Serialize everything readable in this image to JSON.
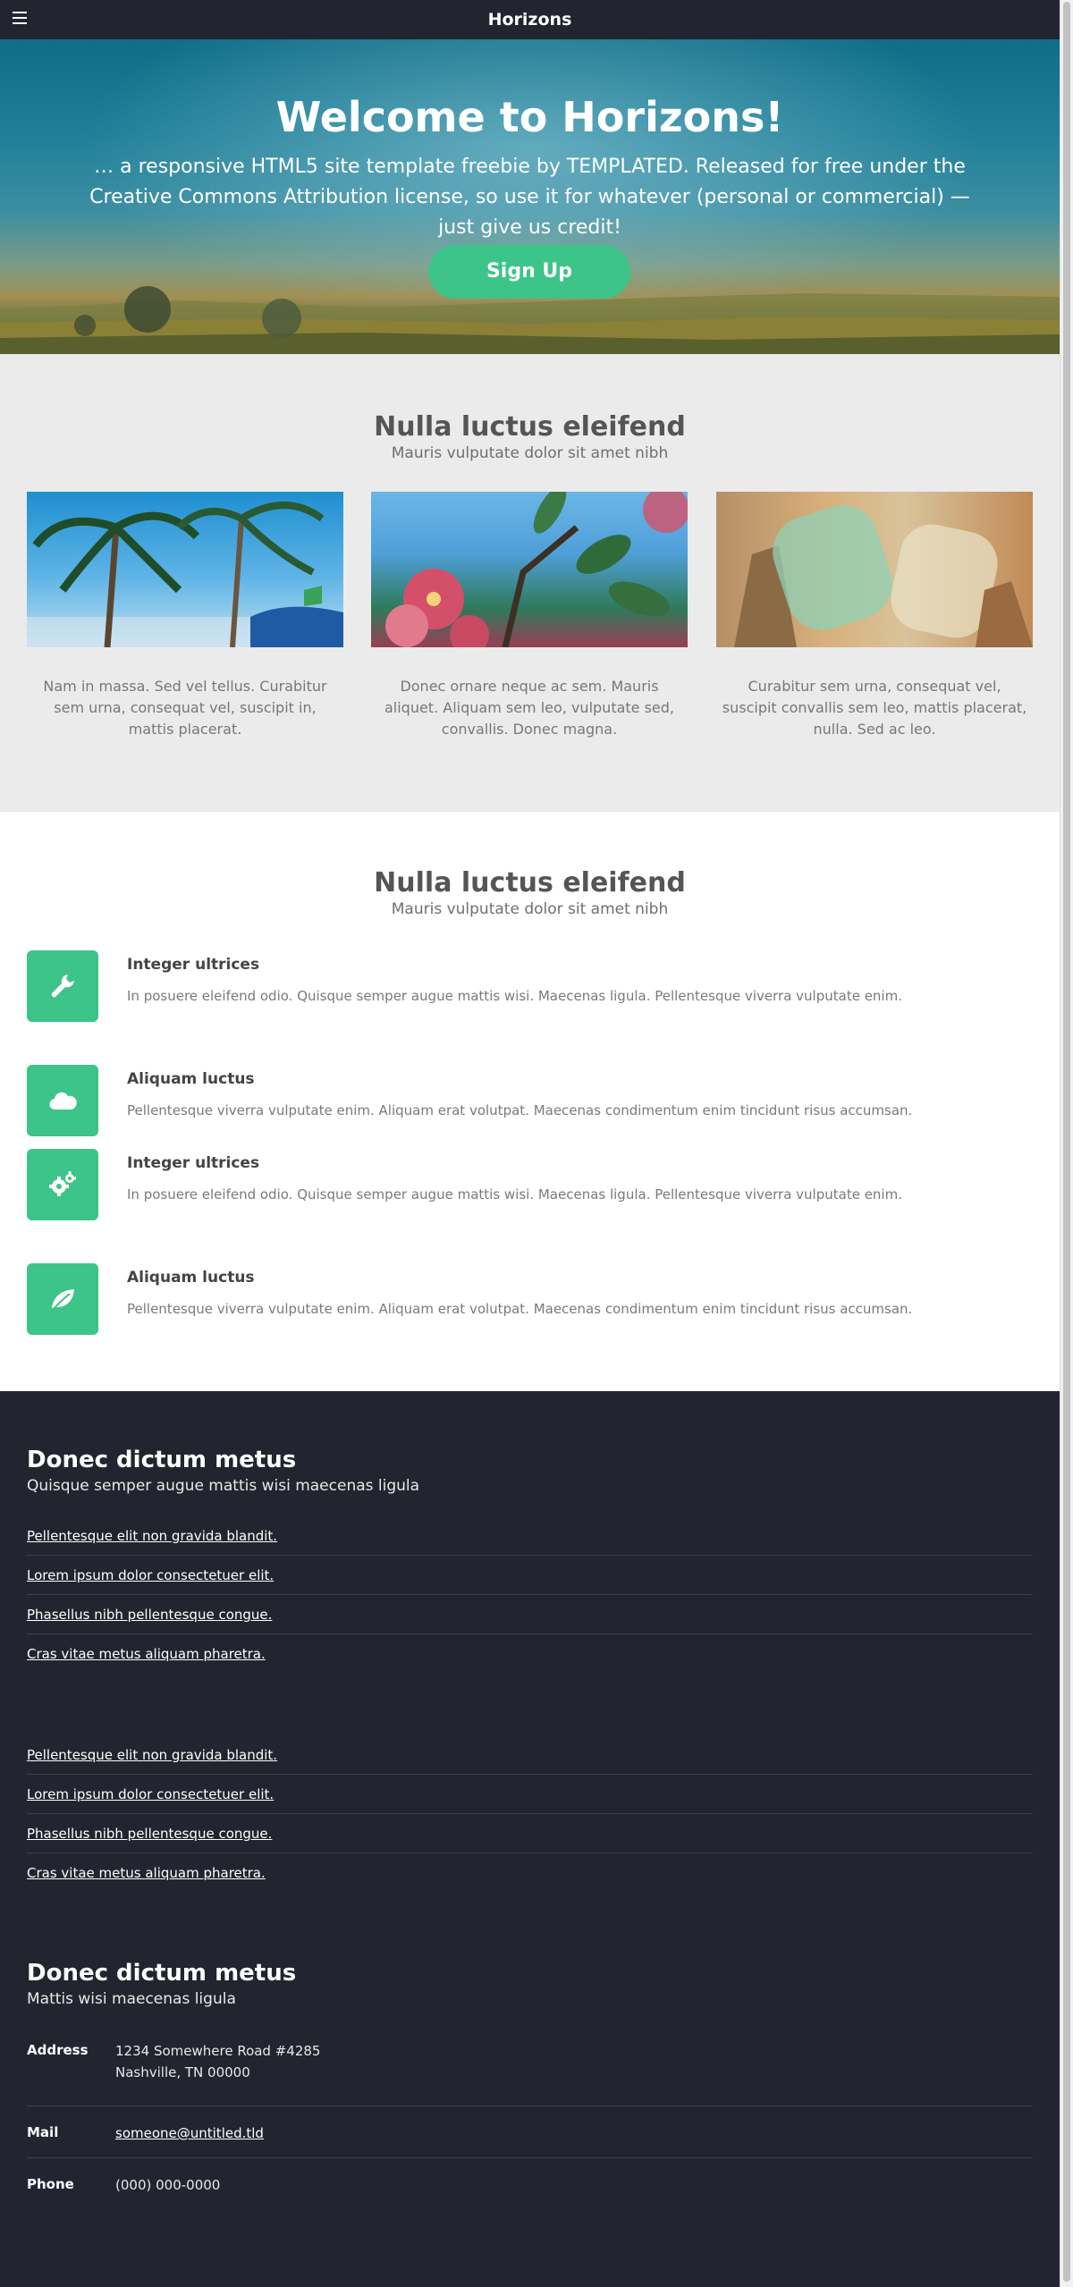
{
  "header": {
    "title": "Horizons",
    "menu_icon": "hamburger-menu-icon"
  },
  "banner": {
    "heading": "Welcome to Horizons!",
    "text": "… a responsive HTML5 site template freebie by TEMPLATED. Released for free under the Creative Commons Attribution license, so use it for whatever (personal or commercial) — just give us credit!",
    "cta_label": "Sign Up"
  },
  "section_one": {
    "title": "Nulla luctus eleifend",
    "subtitle": "Mauris vulputate dolor sit amet nibh",
    "cards": [
      {
        "text": "Nam in massa. Sed vel tellus. Curabitur sem urna, consequat vel, suscipit in, mattis placerat."
      },
      {
        "text": "Donec ornare neque ac sem. Mauris aliquet. Aliquam sem leo, vulputate sed, convallis. Donec magna."
      },
      {
        "text": "Curabitur sem urna, consequat vel, suscipit convallis sem leo, mattis placerat, nulla. Sed ac leo."
      }
    ]
  },
  "section_two": {
    "title": "Nulla luctus eleifend",
    "subtitle": "Mauris vulputate dolor sit amet nibh",
    "features": [
      {
        "icon": "wrench-icon",
        "title": "Integer ultrices",
        "text": "In posuere eleifend odio. Quisque semper augue mattis wisi. Maecenas ligula. Pellentesque viverra vulputate enim."
      },
      {
        "icon": "cloud-icon",
        "title": "Aliquam luctus",
        "text": "Pellentesque viverra vulputate enim. Aliquam erat volutpat. Maecenas condimentum enim tincidunt risus accumsan."
      },
      {
        "icon": "gears-icon",
        "title": "Integer ultrices",
        "text": "In posuere eleifend odio. Quisque semper augue mattis wisi. Maecenas ligula. Pellentesque viverra vulputate enim."
      },
      {
        "icon": "leaf-icon",
        "title": "Aliquam luctus",
        "text": "Pellentesque viverra vulputate enim. Aliquam erat volutpat. Maecenas condimentum enim tincidunt risus accumsan."
      }
    ]
  },
  "footer": {
    "block_one": {
      "title": "Donec dictum metus",
      "subtitle": "Quisque semper augue mattis wisi maecenas ligula"
    },
    "links_one": [
      "Pellentesque elit non gravida blandit.",
      "Lorem ipsum dolor consectetuer elit.",
      "Phasellus nibh pellentesque congue.",
      "Cras vitae metus aliquam pharetra."
    ],
    "links_two": [
      "Pellentesque elit non gravida blandit.",
      "Lorem ipsum dolor consectetuer elit.",
      "Phasellus nibh pellentesque congue.",
      "Cras vitae metus aliquam pharetra."
    ],
    "block_two": {
      "title": "Donec dictum metus",
      "subtitle": "Mattis wisi maecenas ligula"
    },
    "contact": {
      "address_label": "Address",
      "address_line1": "1234 Somewhere Road #4285",
      "address_line2": "Nashville, TN 00000",
      "mail_label": "Mail",
      "mail_value": "someone@untitled.tld",
      "phone_label": "Phone",
      "phone_value": "(000) 000-0000"
    }
  },
  "colors": {
    "accent": "#3dc488",
    "dark": "#22252f",
    "light_section": "#ebebeb"
  }
}
